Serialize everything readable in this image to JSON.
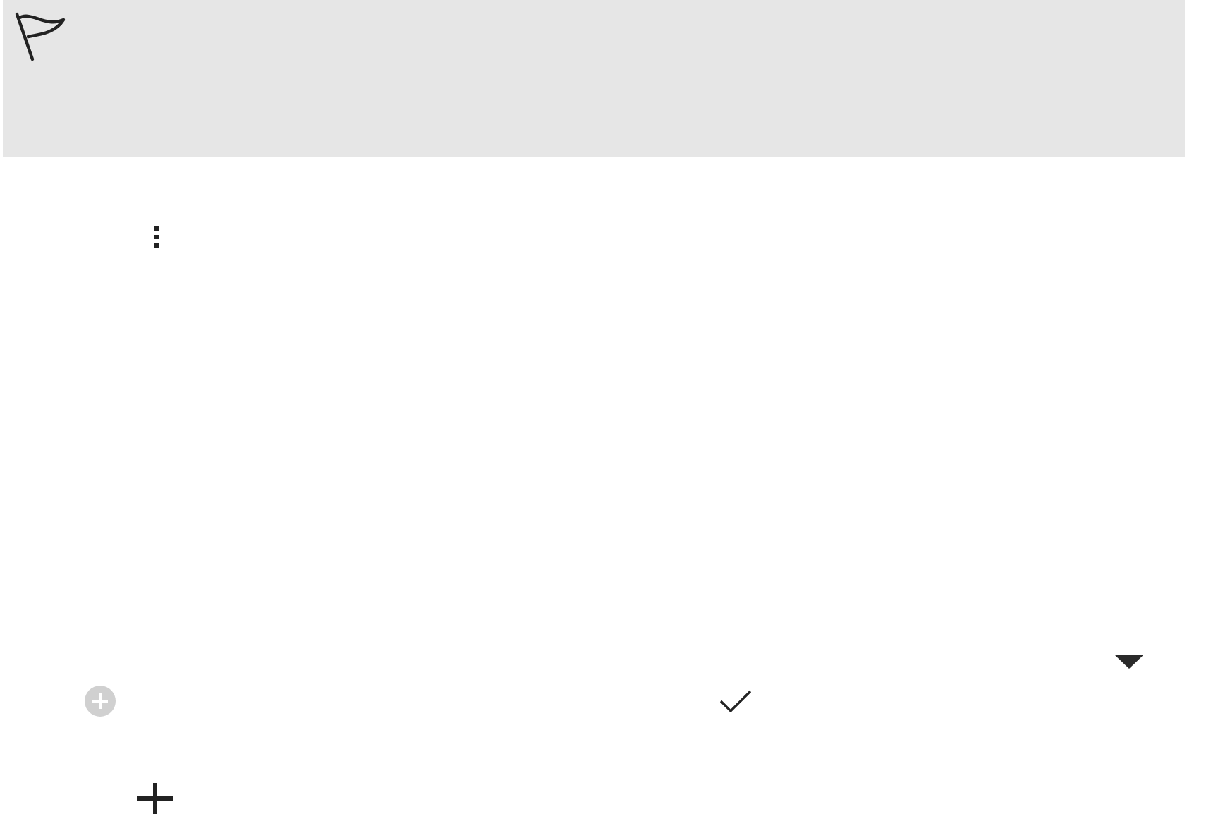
{
  "header": {
    "flag": true
  },
  "toolbar": {
    "more_menu": true
  },
  "form": {
    "dropdown_open": false,
    "add_disabled": true,
    "checked": true
  },
  "footer": {
    "add": true
  }
}
